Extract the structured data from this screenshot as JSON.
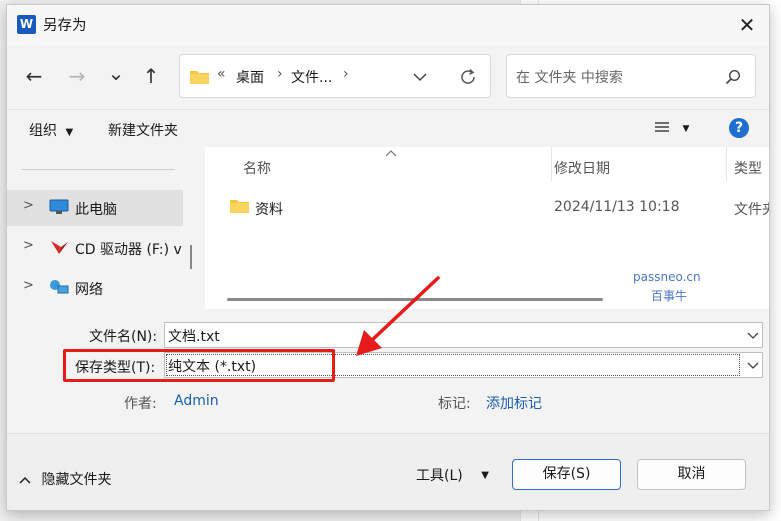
{
  "dialog": {
    "title": "另存为",
    "app_icon": "W"
  },
  "nav": {
    "back": "←",
    "forward": "→",
    "recent": "⌄",
    "up": "↑"
  },
  "address": {
    "overflow": "«",
    "crumb1": "桌面",
    "sep": "›",
    "crumb2": "文件...",
    "sep2": "›"
  },
  "search": {
    "placeholder": "在 文件夹 中搜索"
  },
  "toolbar": {
    "organize": "组织",
    "new_folder": "新建文件夹",
    "help": "?"
  },
  "sidebar": {
    "items": [
      {
        "label": "此电脑",
        "icon": "monitor-icon"
      },
      {
        "label": "CD 驱动器 (F:) v",
        "icon": "cd-drive-icon"
      },
      {
        "label": "网络",
        "icon": "network-icon"
      }
    ]
  },
  "files": {
    "columns": {
      "name": "名称",
      "date": "修改日期",
      "type": "类型"
    },
    "rows": [
      {
        "name": "资料",
        "date": "2024/11/13 10:18",
        "type": "文件夹"
      }
    ]
  },
  "form": {
    "filename_label": "文件名(N):",
    "filename_value": "文档.txt",
    "filetype_label": "保存类型(T):",
    "filetype_value": "纯文本 (*.txt)",
    "author_label": "作者:",
    "author_value": "Admin",
    "tags_label": "标记:",
    "tags_value": "添加标记"
  },
  "footer": {
    "hide_folders": "隐藏文件夹",
    "tools": "工具(L)",
    "save": "保存(S)",
    "cancel": "取消"
  },
  "watermark": {
    "line1": "passneo.cn",
    "line2": "百事牛"
  },
  "colors": {
    "accent": "#2f6fc8",
    "highlight": "#e81b1b",
    "link": "#1a5fb4",
    "folder": "#f4c542"
  }
}
